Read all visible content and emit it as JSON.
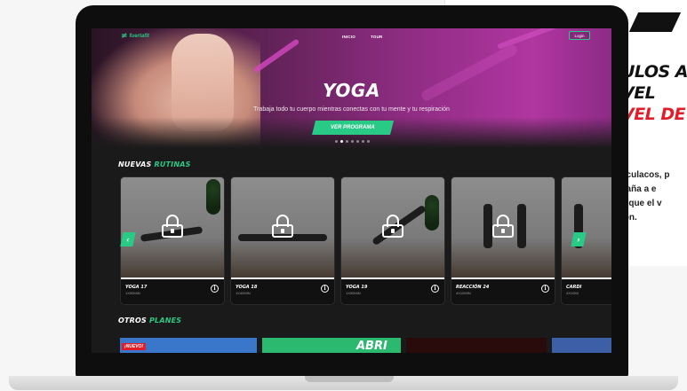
{
  "nav": {
    "brand": "fuertafit",
    "links": [
      "INICIO",
      "TOUR"
    ],
    "login": "Login"
  },
  "hero": {
    "title": "YOGA",
    "subtitle": "Trabaja todo tu cuerpo mientras conectas con tu mente y tu respiración",
    "cta": "VER PROGRAMA",
    "slide_count": 7,
    "active_slide": 2
  },
  "sections": {
    "new_routines": {
      "label": "NUEVAS ",
      "accent": "RUTINAS"
    },
    "other_plans": {
      "label": "OTROS ",
      "accent": "PLANES"
    }
  },
  "routines": [
    {
      "title": "YOGA 17",
      "meta": "1X50MIN"
    },
    {
      "title": "YOGA 18",
      "meta": "1X40MIN"
    },
    {
      "title": "YOGA 19",
      "meta": "1X50MIN"
    },
    {
      "title": "REACCIÓN 24",
      "meta": "4X10MIN"
    },
    {
      "title": "CARDI",
      "meta": "4X10MI"
    }
  ],
  "plans": [
    {
      "tag": "¡NUEVO!",
      "text": ""
    },
    {
      "tag": "",
      "text": "ABRI"
    }
  ],
  "promo": {
    "lines": [
      "ULOS A",
      "VEL",
      "VEL DE"
    ],
    "text": [
      "sculacos, p",
      "caña a e",
      "s que el v",
      "ión."
    ]
  },
  "colors": {
    "accent": "#29c986",
    "hero_purple": "#8e2c82",
    "promo_red": "#e11d2a"
  }
}
